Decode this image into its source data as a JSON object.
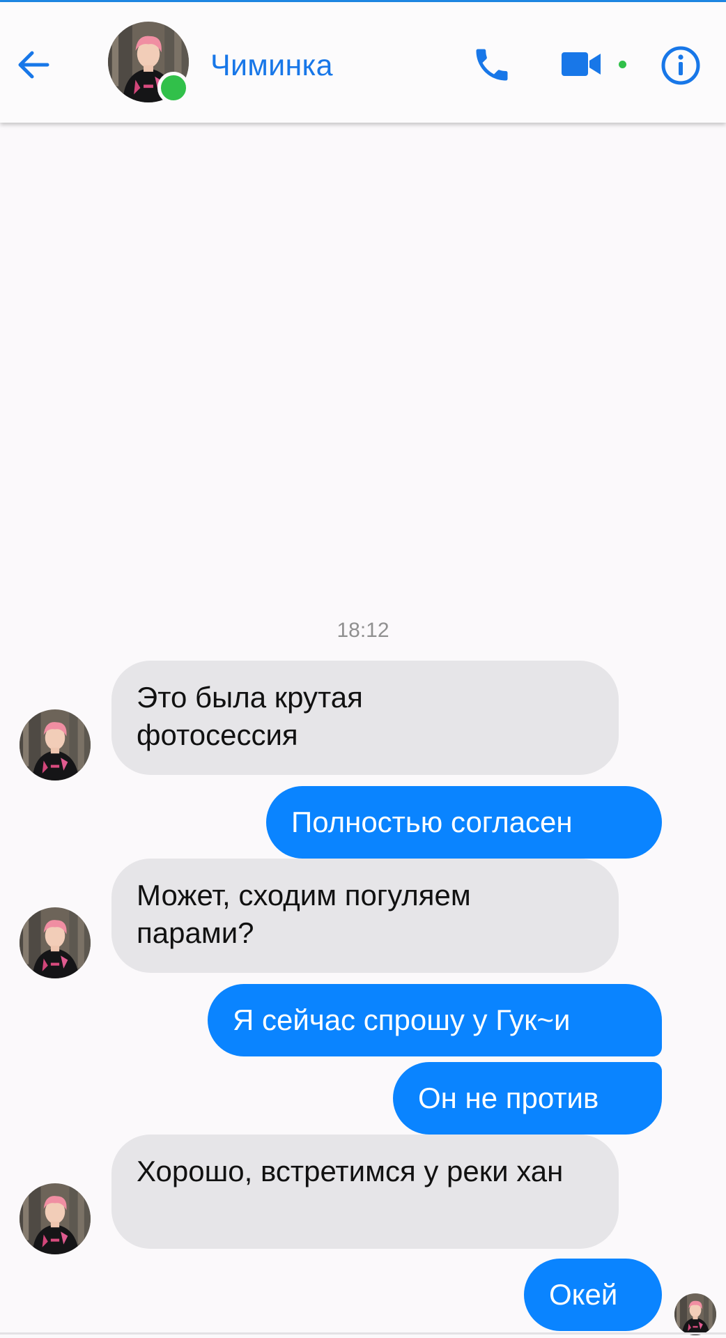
{
  "header": {
    "contact_name": "Чиминка",
    "online": true
  },
  "icons": {
    "back": "arrow-left-icon",
    "phone": "phone-icon",
    "video": "video-camera-icon",
    "info": "info-icon"
  },
  "colors": {
    "accent": "#1877e8",
    "outgoing_bubble": "#0a84ff",
    "incoming_bubble": "#e6e5e8",
    "online": "#31c04a"
  },
  "conversation": {
    "timestamp": "18:12",
    "messages": [
      {
        "direction": "incoming",
        "text": "Это была крутая фотосессия"
      },
      {
        "direction": "outgoing",
        "text": "Полностью согласен"
      },
      {
        "direction": "incoming",
        "text": "Может, сходим погуляем парами?"
      },
      {
        "direction": "outgoing",
        "text": "Я сейчас спрошу у Гук~и"
      },
      {
        "direction": "outgoing",
        "text": "Он не против"
      },
      {
        "direction": "incoming",
        "text": "Хорошо, встретимся у реки хан"
      },
      {
        "direction": "outgoing",
        "text": "Окей"
      }
    ]
  }
}
